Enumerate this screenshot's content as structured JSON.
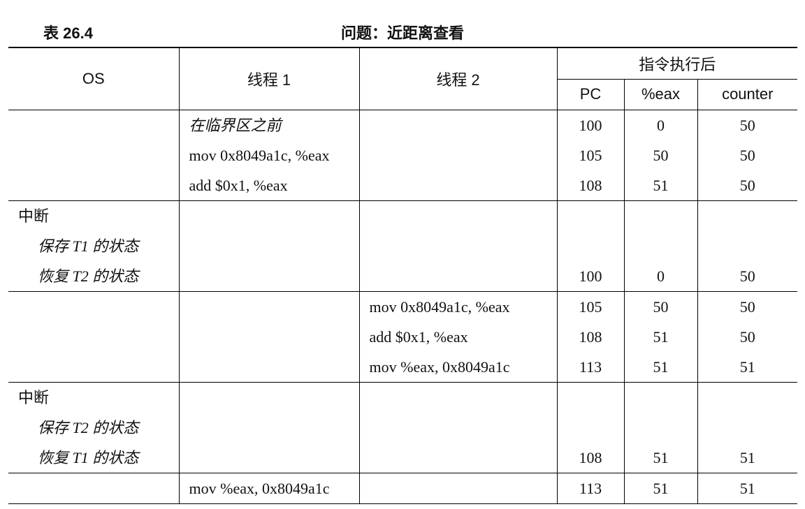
{
  "caption": {
    "number": "表 26.4",
    "title": "问题：近距离查看"
  },
  "header": {
    "os": "OS",
    "thread1": "线程 1",
    "thread2": "线程 2",
    "after": "指令执行后",
    "pc": "PC",
    "eax": "%eax",
    "counter": "counter"
  },
  "groups": [
    {
      "os": [],
      "t1": [
        "在临界区之前",
        "mov 0x8049a1c, %eax",
        "add $0x1, %eax"
      ],
      "t2": [],
      "pc": [
        "100",
        "105",
        "108"
      ],
      "eax": [
        "0",
        "50",
        "51"
      ],
      "counter": [
        "50",
        "50",
        "50"
      ]
    },
    {
      "os": [
        "中断",
        "保存 T1 的状态",
        "恢复 T2 的状态"
      ],
      "t1": [],
      "t2": [],
      "pc": [
        "",
        "",
        "100"
      ],
      "eax": [
        "",
        "",
        "0"
      ],
      "counter": [
        "",
        "",
        "50"
      ]
    },
    {
      "os": [],
      "t1": [],
      "t2": [
        "mov 0x8049a1c, %eax",
        "add $0x1, %eax",
        "mov %eax, 0x8049a1c"
      ],
      "pc": [
        "105",
        "108",
        "113"
      ],
      "eax": [
        "50",
        "51",
        "51"
      ],
      "counter": [
        "50",
        "50",
        "51"
      ]
    },
    {
      "os": [
        "中断",
        "保存 T2 的状态",
        "恢复 T1 的状态"
      ],
      "t1": [],
      "t2": [],
      "pc": [
        "",
        "",
        "108"
      ],
      "eax": [
        "",
        "",
        "51"
      ],
      "counter": [
        "",
        "",
        "51"
      ]
    },
    {
      "os": [],
      "t1": [
        "mov %eax, 0x8049a1c"
      ],
      "t2": [],
      "pc": [
        "113"
      ],
      "eax": [
        "51"
      ],
      "counter": [
        "51"
      ]
    }
  ]
}
